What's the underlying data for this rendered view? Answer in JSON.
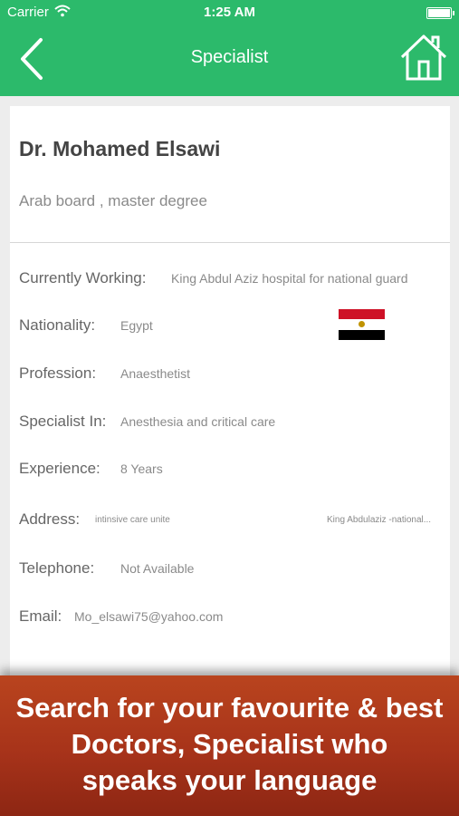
{
  "status": {
    "carrier": "Carrier",
    "time": "1:25 AM"
  },
  "nav": {
    "title": "Specialist"
  },
  "profile": {
    "name": "Dr. Mohamed Elsawi",
    "degree": "Arab board , master degree"
  },
  "details": {
    "working_label": "Currently Working:",
    "working_value": "King Abdul Aziz hospital for national guard",
    "nationality_label": "Nationality:",
    "nationality_value": "Egypt",
    "profession_label": "Profession:",
    "profession_value": "Anaesthetist",
    "specialist_label": "Specialist In:",
    "specialist_value": "Anesthesia and critical care",
    "experience_label": "Experience:",
    "experience_value": "8 Years",
    "address_label": "Address:",
    "address_value1": "intinsive care unite",
    "address_value2": "King Abdulaziz -national...",
    "telephone_label": "Telephone:",
    "telephone_value": "Not Available",
    "email_label": "Email:",
    "email_value": "Mo_elsawi75@yahoo.com"
  },
  "flag": {
    "colors": [
      "#ce1126",
      "#ffffff",
      "#000000"
    ],
    "emblem": "#c09300"
  },
  "banner": {
    "line1": "Search for your favourite & best",
    "line2": "Doctors, Specialist who",
    "line3": "speaks your language"
  },
  "colors": {
    "accent": "#2cba6b",
    "banner": "#a7331a"
  },
  "icons": {
    "back": "chevron-left-icon",
    "home": "home-icon",
    "wifi": "wifi-icon",
    "battery": "battery-icon"
  }
}
